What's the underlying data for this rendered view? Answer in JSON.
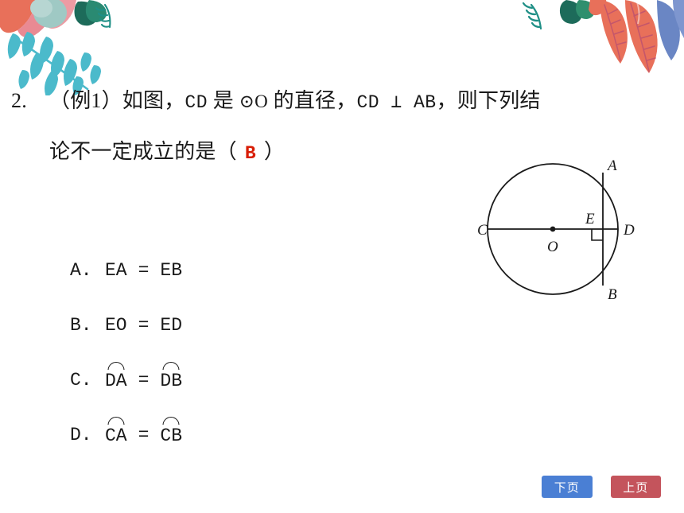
{
  "slide": {
    "background_color": "#ffffff",
    "question_number": "2.",
    "question_line1_prefix": "（例1）如图，",
    "question_cd": "CD",
    "question_mid1": " 是 ",
    "question_circle_o": "⊙O",
    "question_mid2": " 的直径，",
    "question_cd2": "CD",
    "question_perp": " ⊥ ",
    "question_ab": "AB",
    "question_mid3": "，则下列结",
    "question_line2_prefix": "论不一定成立的是（",
    "answer_letter": "B",
    "answer_color": "#d81e06",
    "question_line2_suffix": "）"
  },
  "options": [
    {
      "key": "A.",
      "left": "EA",
      "eq": "=",
      "right": "EB",
      "arc": false
    },
    {
      "key": "B.",
      "left": "EO",
      "eq": "=",
      "right": "ED",
      "arc": false
    },
    {
      "key": "C.",
      "left": "DA",
      "eq": "=",
      "right": "DB",
      "arc": true
    },
    {
      "key": "D.",
      "left": "CA",
      "eq": "=",
      "right": "CB",
      "arc": true
    }
  ],
  "figure": {
    "description": "circle-with-diameter-and-perpendicular-chord",
    "labels": {
      "center": "O",
      "left_diameter": "C",
      "right_diameter": "D",
      "chord_top": "A",
      "chord_bottom": "B",
      "intersection": "E"
    },
    "stroke_color": "#1a1a1a"
  },
  "nav": {
    "next_label": "下页",
    "next_color": "#4a7fd4",
    "prev_label": "上页",
    "prev_color": "#c4545c"
  },
  "decor": {
    "teal": "#4bbacb",
    "teal_dark": "#1f8f86",
    "coral": "#e8705a",
    "coral_vein": "#c4566b",
    "pink": "#e98a93",
    "blue": "#6a86c4",
    "green_dark": "#1d6b5a",
    "sage": "#9fc9c4"
  }
}
